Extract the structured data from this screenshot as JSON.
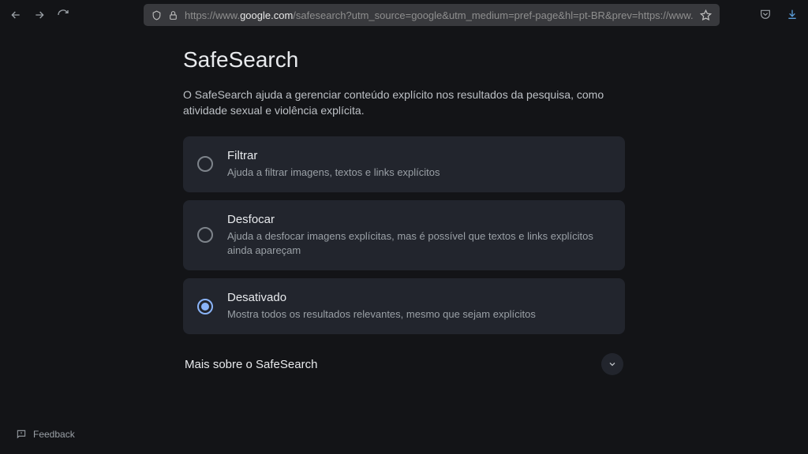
{
  "browser": {
    "url_prefix": "https://www.",
    "url_domain": "google.com",
    "url_suffix": "/safesearch?utm_source=google&utm_medium=pref-page&hl=pt-BR&prev=https://www.goo"
  },
  "page": {
    "title": "SafeSearch",
    "description": "O SafeSearch ajuda a gerenciar conteúdo explícito nos resultados da pesquisa, como atividade sexual e violência explícita."
  },
  "options": [
    {
      "title": "Filtrar",
      "desc": "Ajuda a filtrar imagens, textos e links explícitos",
      "selected": false
    },
    {
      "title": "Desfocar",
      "desc": "Ajuda a desfocar imagens explícitas, mas é possível que textos e links explícitos ainda apareçam",
      "selected": false
    },
    {
      "title": "Desativado",
      "desc": "Mostra todos os resultados relevantes, mesmo que sejam explícitos",
      "selected": true
    }
  ],
  "more": {
    "label": "Mais sobre o SafeSearch"
  },
  "feedback": {
    "label": "Feedback"
  }
}
